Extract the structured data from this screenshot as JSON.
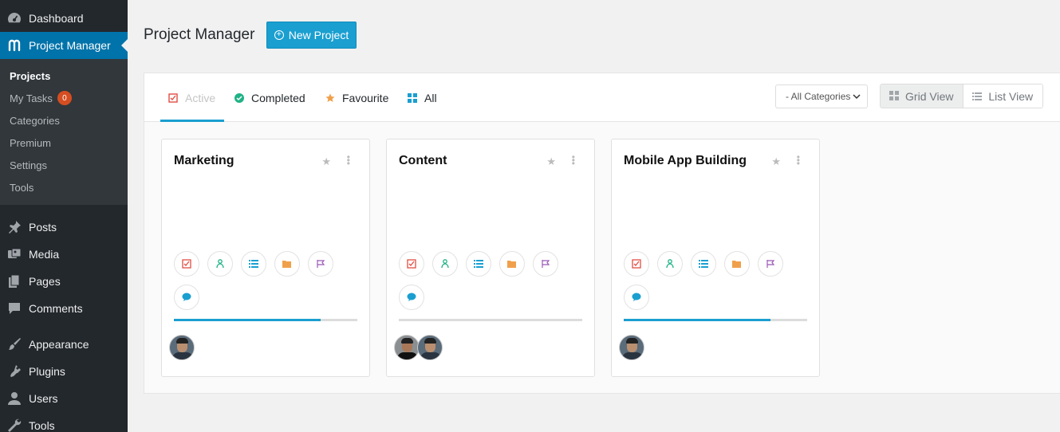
{
  "sidebar": {
    "top_items": [
      {
        "label": "Dashboard",
        "icon": "dashboard-icon"
      },
      {
        "label": "Project Manager",
        "icon": "project-manager-logo-icon"
      }
    ],
    "submenu": [
      {
        "label": "Projects"
      },
      {
        "label": "My Tasks",
        "badge": "0"
      },
      {
        "label": "Categories"
      },
      {
        "label": "Premium"
      },
      {
        "label": "Settings"
      },
      {
        "label": "Tools"
      }
    ],
    "bottom_items": [
      {
        "label": "Posts",
        "icon": "pushpin-icon"
      },
      {
        "label": "Media",
        "icon": "media-icon"
      },
      {
        "label": "Pages",
        "icon": "pages-icon"
      },
      {
        "label": "Comments",
        "icon": "comment-icon"
      },
      {
        "label": "Appearance",
        "icon": "paintbrush-icon"
      },
      {
        "label": "Plugins",
        "icon": "plug-icon"
      },
      {
        "label": "Users",
        "icon": "user-icon"
      },
      {
        "label": "Tools",
        "icon": "wrench-icon"
      }
    ]
  },
  "header": {
    "title": "Project Manager",
    "new_project_label": "New Project"
  },
  "tabs": [
    {
      "label": "Active",
      "icon": "check-square-icon",
      "color": "#e14d43"
    },
    {
      "label": "Completed",
      "icon": "check-circle-icon",
      "color": "#20b286"
    },
    {
      "label": "Favourite",
      "icon": "star-icon",
      "color": "#f0a04b"
    },
    {
      "label": "All",
      "icon": "grid-icon",
      "color": "#1a9fd0"
    }
  ],
  "category_select": {
    "selected": "- All Categories"
  },
  "view_switch": {
    "grid_label": "Grid View",
    "list_label": "List View"
  },
  "projects": [
    {
      "title": "Marketing",
      "progress": 0.8,
      "avatars": 1
    },
    {
      "title": "Content",
      "progress": 0.0,
      "avatars": 2
    },
    {
      "title": "Mobile App Building",
      "progress": 0.8,
      "avatars": 1
    }
  ],
  "colors": {
    "accent": "#1a9fd0",
    "sidebar_bg": "#23282d",
    "sidebar_active": "#0073aa",
    "badge": "#d54e21"
  }
}
